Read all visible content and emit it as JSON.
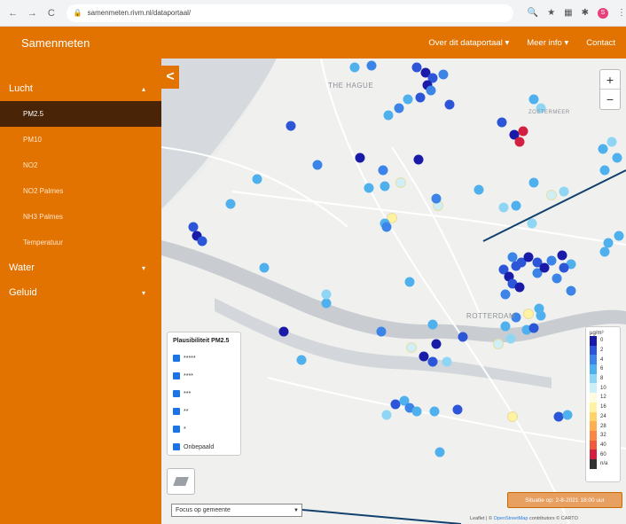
{
  "browser": {
    "url": "samenmeten.rivm.nl/dataportaal/",
    "nav_back": "←",
    "nav_forward": "→",
    "nav_reload": "C",
    "lock": "🔒",
    "icons": [
      "search-icon",
      "star-icon",
      "extension-icon",
      "puzzle-icon",
      "menu-icon"
    ],
    "avatar": "S"
  },
  "header": {
    "title": "Samenmeten",
    "nav": [
      "Over dit dataportaal ▾",
      "Meer info ▾",
      "Contact"
    ]
  },
  "sidebar": {
    "groups": [
      {
        "label": "Lucht",
        "chev": "▴",
        "items": [
          "PM2.5",
          "PM10",
          "NO2",
          "NO2 Palmes",
          "NH3 Palmes",
          "Temperatuur"
        ]
      },
      {
        "label": "Water",
        "chev": "▾"
      },
      {
        "label": "Geluid",
        "chev": "▾"
      }
    ],
    "active": "PM2.5"
  },
  "map": {
    "collapse": "<",
    "zoom_in": "+",
    "zoom_out": "−",
    "labels": [
      {
        "text": "THE HAGUE"
      },
      {
        "text": "ZOETERMEER"
      },
      {
        "text": "ROTTERDAM"
      }
    ],
    "legend_title": "Plausibiliteit PM2.5",
    "legend_items": [
      "*****",
      "****",
      "***",
      "**",
      "*",
      "Onbepaald"
    ],
    "focus_select": "Focus op gemeente",
    "scale_title": "µg/m³",
    "scale": [
      {
        "label": "0",
        "color": "#1a1aa8"
      },
      {
        "label": "2",
        "color": "#2c55d8"
      },
      {
        "label": "4",
        "color": "#3c84e8"
      },
      {
        "label": "6",
        "color": "#4fb0ee"
      },
      {
        "label": "8",
        "color": "#8ed6f4"
      },
      {
        "label": "10",
        "color": "#cdeff8"
      },
      {
        "label": "12",
        "color": "#fffbe0"
      },
      {
        "label": "16",
        "color": "#fff2a0"
      },
      {
        "label": "24",
        "color": "#ffd36a"
      },
      {
        "label": "28",
        "color": "#ffae52"
      },
      {
        "label": "32",
        "color": "#f88644"
      },
      {
        "label": "40",
        "color": "#ee5a3a"
      },
      {
        "label": "60",
        "color": "#d42040"
      },
      {
        "label": "n/a",
        "color": "#333333"
      }
    ],
    "status": "Situatie op: 2-8-2021 18:00 uur",
    "attribution_prefix": "Leaflet | © ",
    "attribution_link": "OpenStreetMap",
    "attribution_suffix": " contributors © CARTO"
  }
}
